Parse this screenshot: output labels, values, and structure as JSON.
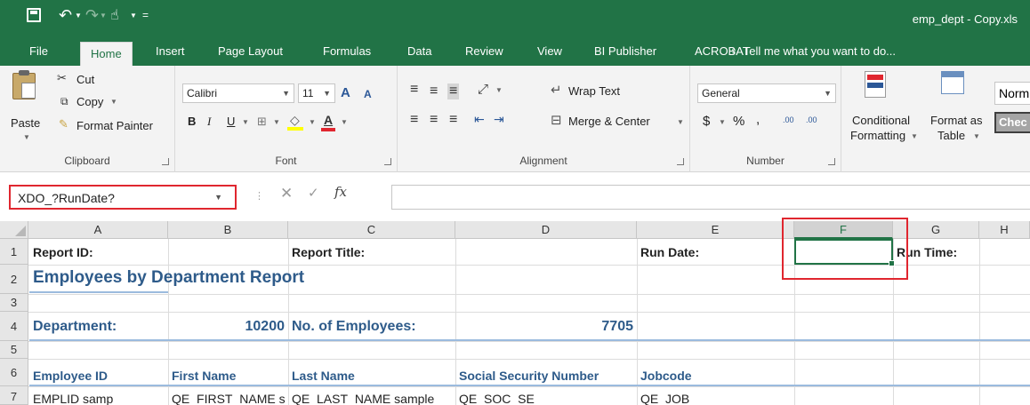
{
  "window": {
    "title": "emp_dept - Copy.xls",
    "accent": "#217346",
    "highlight": "#e0262f"
  },
  "tabs": [
    "File",
    "Home",
    "Insert",
    "Page Layout",
    "Formulas",
    "Data",
    "Review",
    "View",
    "BI Publisher",
    "ACROBAT"
  ],
  "active_tab": "Home",
  "tell_me": "Tell me what you want to do...",
  "ribbon": {
    "clipboard": {
      "paste": "Paste",
      "cut": "Cut",
      "copy": "Copy",
      "format_painter": "Format Painter",
      "label": "Clipboard"
    },
    "font": {
      "name": "Calibri",
      "size": "11",
      "bold": "B",
      "italic": "I",
      "underline": "U",
      "grow": "A",
      "shrink": "A",
      "font_color": "A",
      "label": "Font"
    },
    "alignment": {
      "wrap_text": "Wrap Text",
      "merge_center": "Merge & Center",
      "label": "Alignment"
    },
    "number": {
      "format": "General",
      "currency": "$",
      "percent": "%",
      "comma": ",",
      "inc_decimal": ".00",
      "dec_decimal": ".00",
      "label": "Number"
    },
    "styles": {
      "conditional_1": "Conditional",
      "conditional_2": "Formatting",
      "format_as_1": "Format as",
      "format_as_2": "Table",
      "normal": "Norm",
      "check": "Chec"
    }
  },
  "formula_bar": {
    "name_box": "XDO_?RunDate?",
    "fx": "fx",
    "formula": ""
  },
  "columns": [
    "A",
    "B",
    "C",
    "D",
    "E",
    "F",
    "G",
    "H"
  ],
  "selected_column": "F",
  "rows": [
    "1",
    "2",
    "3",
    "4",
    "5",
    "6",
    "7"
  ],
  "cells": {
    "report_id": "Report ID:",
    "report_title": "Report Title:",
    "run_date": "Run Date:",
    "run_time": "Run Time:",
    "heading": "Employees by Department Report",
    "department_label": "Department:",
    "department_value": "10200",
    "num_employees_label": "No. of Employees:",
    "num_employees_value": "7705",
    "hdr_employee_id": "Employee ID",
    "hdr_first_name": "First Name",
    "hdr_last_name": "Last Name",
    "hdr_ssn": "Social Security Number",
    "hdr_jobcode": "Jobcode",
    "r7_a": "EMPLID samp",
    "r7_b": "QE_FIRST_NAME s",
    "r7_c": "QE_LAST_NAME sample",
    "r7_d": "QE_SOC_SE",
    "r7_e": "QE_JOB"
  }
}
